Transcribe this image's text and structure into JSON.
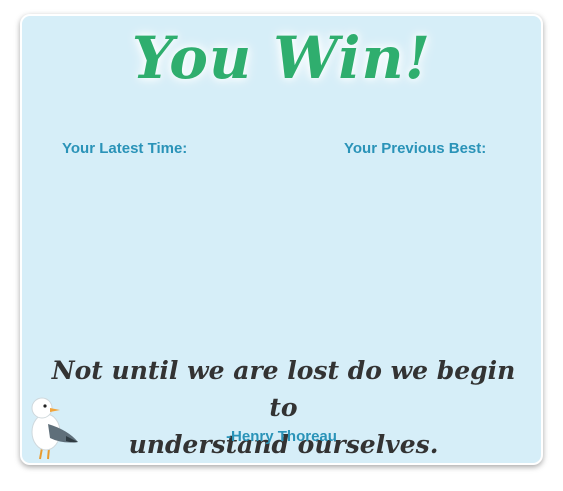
{
  "title": "You Win!",
  "stats": {
    "latest_label": "Your Latest Time:",
    "previous_label": "Your Previous Best:"
  },
  "quote": {
    "line1": "Not until we are lost do we begin to",
    "line2": "understand ourselves.",
    "author": "-Henry Thoreau"
  },
  "colors": {
    "panel_bg": "#d6eef8",
    "title_green": "#2fae6e",
    "label_blue": "#2a93b8",
    "quote_text": "#333333"
  },
  "icons": {
    "mascot": "seagull-icon"
  }
}
